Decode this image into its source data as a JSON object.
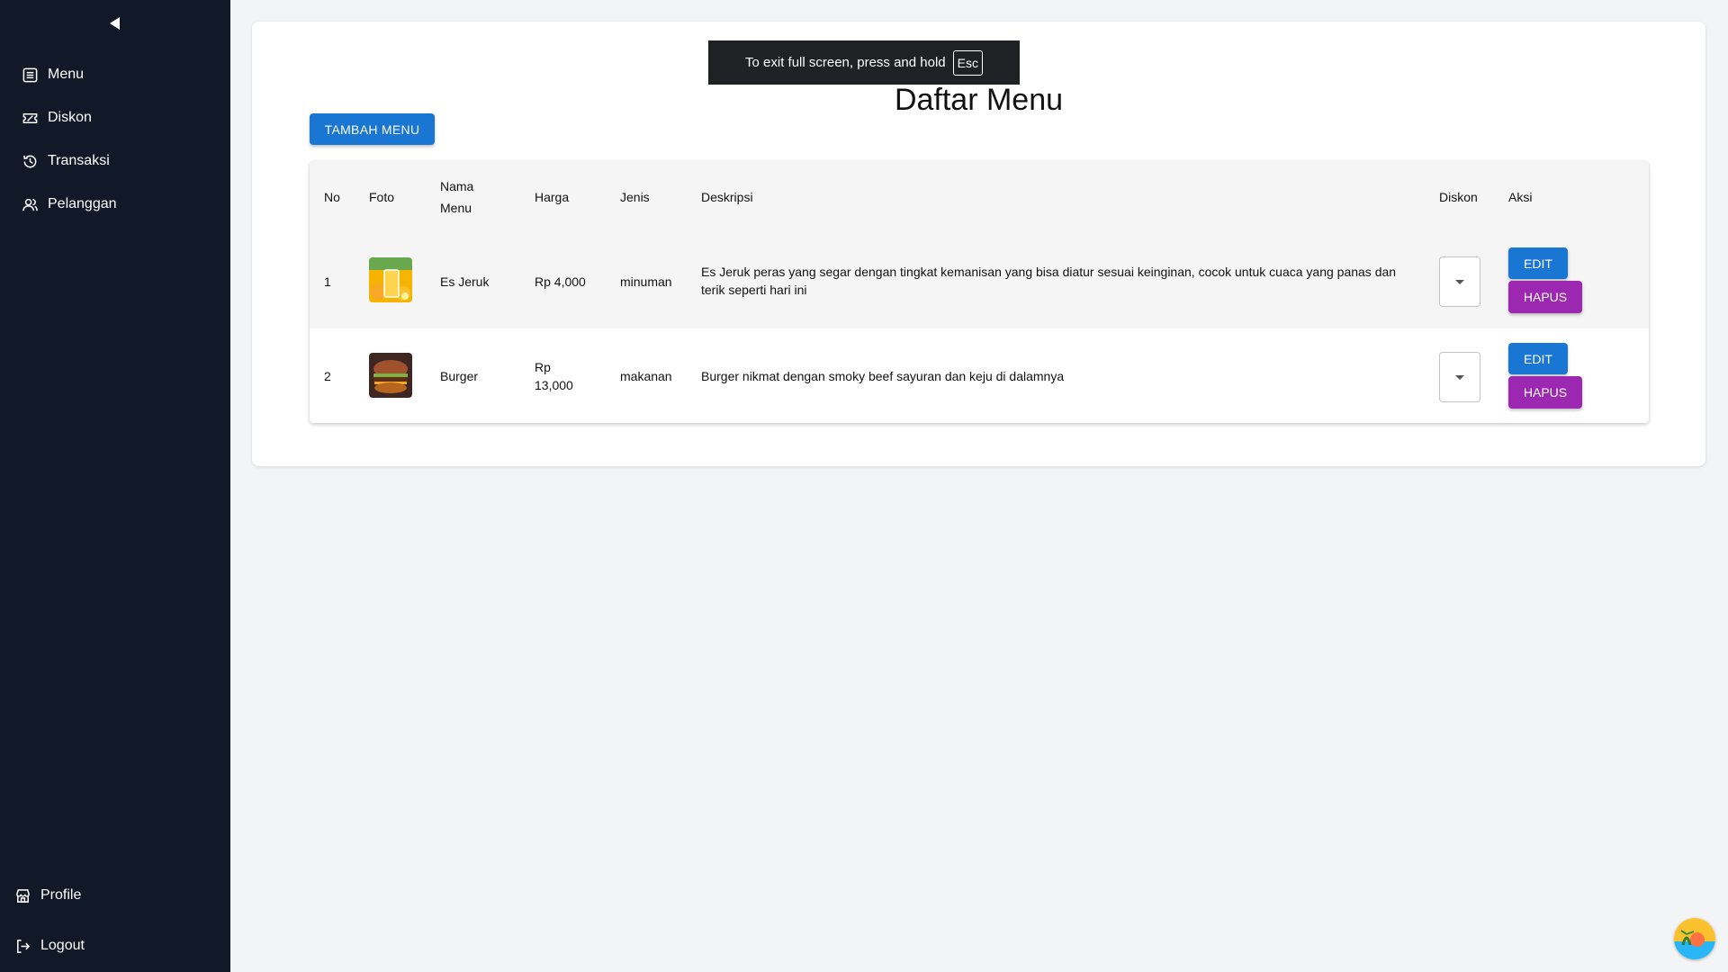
{
  "sidebar": {
    "items": [
      {
        "label": "Menu",
        "icon": "list-icon"
      },
      {
        "label": "Diskon",
        "icon": "ticket-icon"
      },
      {
        "label": "Transaksi",
        "icon": "history-icon"
      },
      {
        "label": "Pelanggan",
        "icon": "users-icon"
      }
    ],
    "bottom": [
      {
        "label": "Profile",
        "icon": "store-icon"
      },
      {
        "label": "Logout",
        "icon": "logout-icon"
      }
    ]
  },
  "main": {
    "title": "Daftar Menu",
    "add_button": "TAMBAH MENU",
    "table": {
      "headers": {
        "no": "No",
        "foto": "Foto",
        "nama_1": "Nama",
        "nama_2": "Menu",
        "harga": "Harga",
        "jenis": "Jenis",
        "deskripsi": "Deskripsi",
        "diskon": "Diskon",
        "aksi": "Aksi"
      },
      "rows": [
        {
          "no": "1",
          "nama": "Es Jeruk",
          "harga_1": "Rp 4,000",
          "harga_2": "",
          "jenis": "minuman",
          "deskripsi": "Es Jeruk peras yang segar dengan tingkat kemanisan yang bisa diatur sesuai keinginan, cocok untuk cuaca yang panas dan terik seperti hari ini",
          "edit": "EDIT",
          "hapus": "HAPUS"
        },
        {
          "no": "2",
          "nama": "Burger",
          "harga_1": "Rp",
          "harga_2": "13,000",
          "jenis": "makanan",
          "deskripsi": "Burger nikmat dengan smoky beef sayuran dan keju di dalamnya",
          "edit": "EDIT",
          "hapus": "HAPUS"
        }
      ]
    }
  },
  "toast": {
    "text": "To exit full screen, press and hold",
    "key": "Esc"
  },
  "colors": {
    "sidebar_bg": "#111827",
    "primary": "#1976d2",
    "danger": "#9c27b0",
    "page_bg": "#f3f4f6"
  }
}
